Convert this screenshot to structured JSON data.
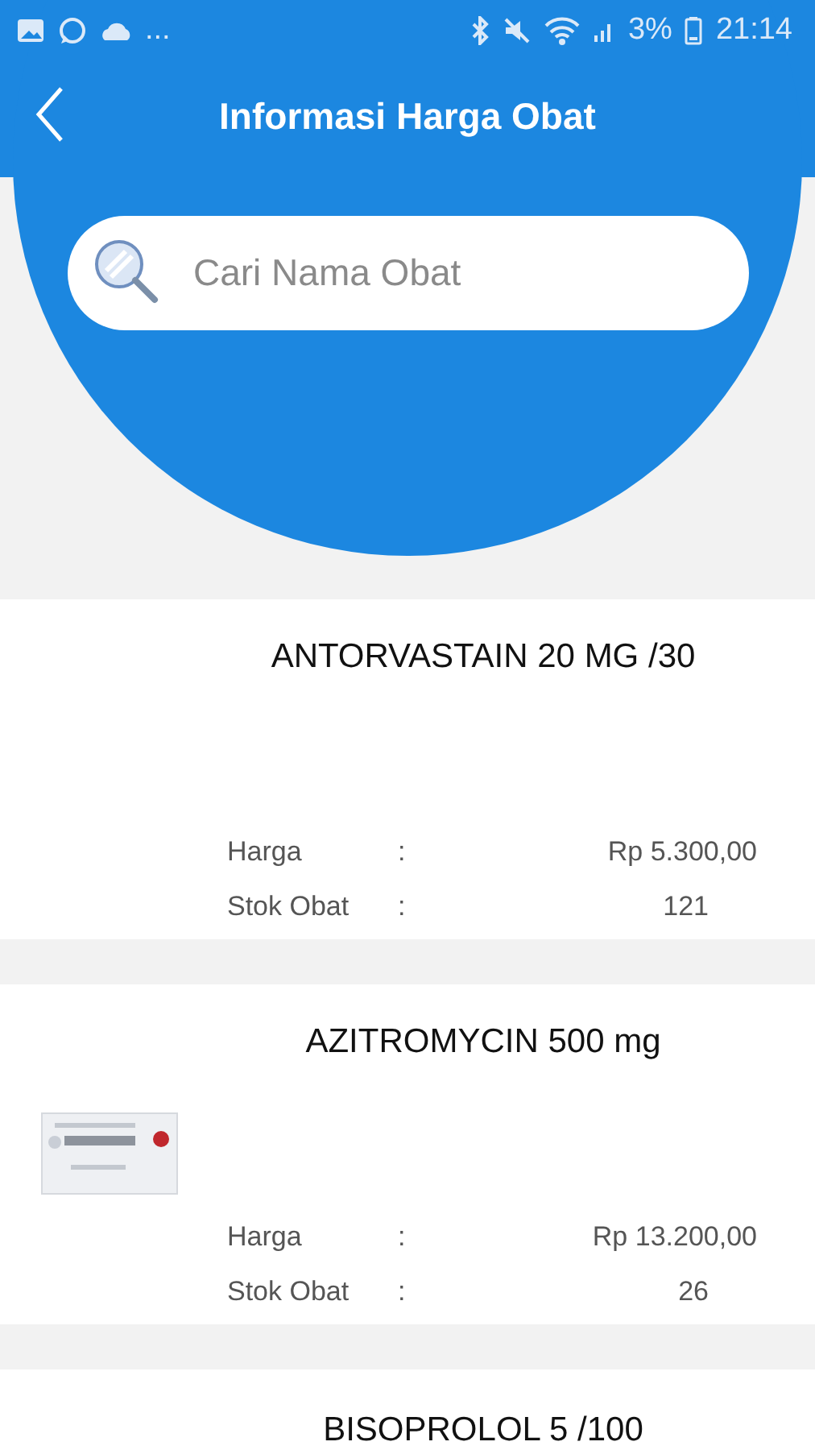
{
  "status_bar": {
    "overflow": "...",
    "battery": "3%",
    "time": "21:14"
  },
  "header": {
    "title": "Informasi Harga Obat"
  },
  "search": {
    "placeholder": "Cari Nama Obat"
  },
  "items": [
    {
      "name": "ANTORVASTAIN 20 MG /30",
      "rows": [
        {
          "kind": "price",
          "label": "Harga",
          "sep": ":",
          "value": "Rp 5.300,00"
        },
        {
          "kind": "stock",
          "label": "Stok Obat",
          "sep": ":",
          "value": "121"
        }
      ]
    },
    {
      "name": "AZITROMYCIN 500 mg",
      "image": {
        "kind": "picture"
      },
      "rows": [
        {
          "kind": "price",
          "label": "Harga",
          "sep": ":",
          "value": "Rp 13.200,00"
        },
        {
          "kind": "stock",
          "label": "Stok Obat",
          "sep": ":",
          "value": "26"
        }
      ]
    },
    {
      "name": "BISOPROLOL 5 /100"
    }
  ]
}
